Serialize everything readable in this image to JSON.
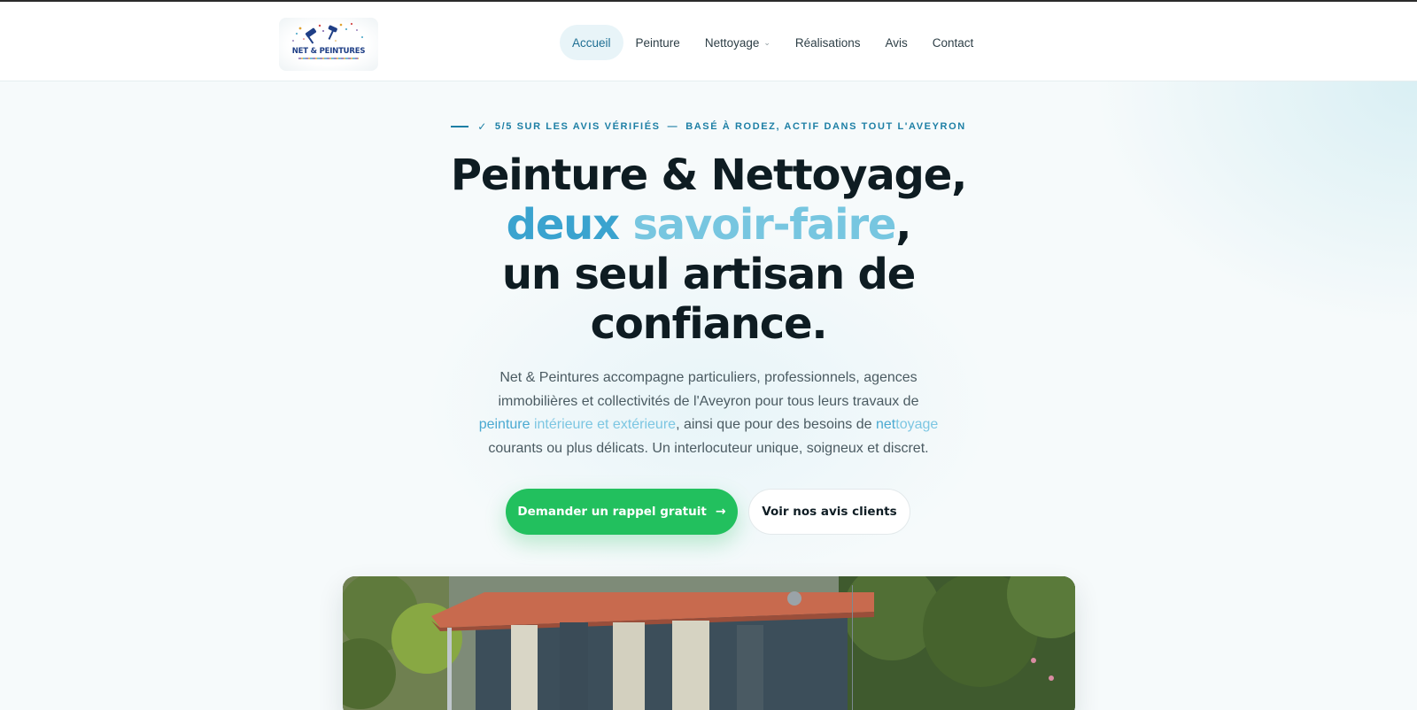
{
  "brand": {
    "logo_text": "NET & PEINTURES",
    "logo_subtitle": "",
    "colors": {
      "primary_cta": "#22c05e",
      "accent_blue": "#3aa3cf",
      "accent_light_blue": "#77c6e0",
      "eyebrow": "#1d7fa5",
      "heading": "#0e1c22"
    }
  },
  "nav": {
    "items": [
      {
        "label": "Accueil",
        "active": true
      },
      {
        "label": "Peinture"
      },
      {
        "label": "Nettoyage",
        "dropdown": true
      },
      {
        "label": "Réalisations"
      },
      {
        "label": "Avis"
      },
      {
        "label": "Contact"
      }
    ]
  },
  "hero": {
    "eyebrow_rating": "5/5 SUR LES AVIS VÉRIFIÉS",
    "eyebrow_separator": "—",
    "eyebrow_location": "BASÉ À RODEZ, ACTIF DANS TOUT L'AVEYRON",
    "title_line1": "Peinture & Nettoyage,",
    "title_word1": "deux",
    "title_word2": "savoir-faire",
    "title_comma": ",",
    "title_line3": "un seul artisan de",
    "title_line4": "confiance.",
    "lead_part1": "Net & Peintures accompagne particuliers, professionnels, agences immobilières et collectivités de l'Aveyron pour tous leurs travaux de ",
    "lead_link1_a": "peinture ",
    "lead_link1_b": "intérieure et extérieure",
    "lead_part2": ", ainsi que pour des besoins de ",
    "lead_link2_a": "net",
    "lead_link2_b": "toyage",
    "lead_part3": " courants ou plus délicats. Un interlocuteur unique, soigneux et discret.",
    "cta_primary": "Demander un rappel gratuit",
    "cta_primary_icon": "arrow-right-icon",
    "cta_secondary": "Voir nos avis clients"
  }
}
